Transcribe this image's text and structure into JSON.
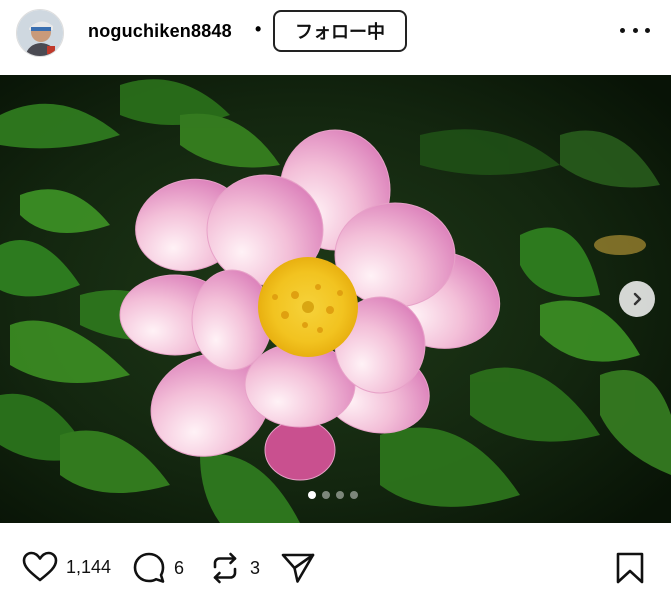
{
  "post": {
    "username": "noguchiken8848",
    "separator": "•",
    "follow_label": "フォロー中",
    "more_icon": "more-horizontal-icon"
  },
  "media": {
    "current_index": 1,
    "total_slides": 4,
    "next_icon": "chevron-right-icon"
  },
  "actions": {
    "like_icon": "heart-icon",
    "like_count": "1,144",
    "comment_icon": "comment-bubble-icon",
    "comment_count": "6",
    "repost_icon": "repost-icon",
    "repost_count": "3",
    "share_icon": "paper-plane-icon",
    "save_icon": "bookmark-icon"
  }
}
